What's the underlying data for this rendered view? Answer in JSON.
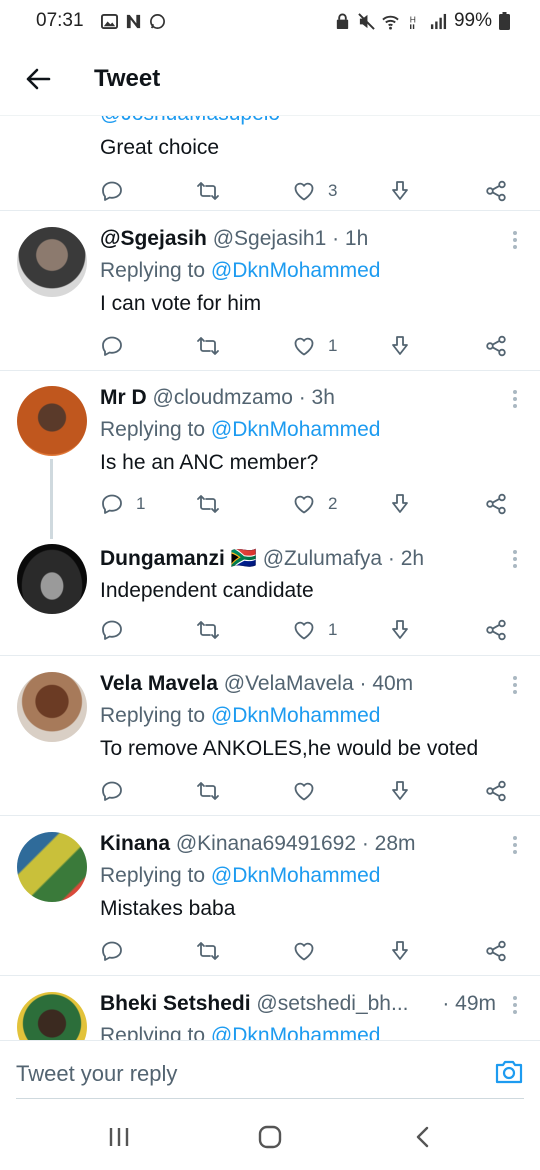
{
  "status_bar": {
    "time": "07:31",
    "notification_icons": [
      "gallery-icon",
      "n-app-icon",
      "whatsapp-icon"
    ],
    "status_icons": [
      "lock-icon",
      "mute-icon",
      "wifi-icon",
      "h-plus-icon",
      "signal-icon"
    ],
    "battery": "99%"
  },
  "header": {
    "title": "Tweet"
  },
  "clipped_top": {
    "handle_fragment": "@JoshuaMasupelo",
    "text": "Great choice",
    "likes": "3"
  },
  "tweets": [
    {
      "name": "@Sgejasih",
      "handle": "@Sgejasih1",
      "time": "· 1h",
      "replying_prefix": "Replying to ",
      "replying_to": "@DknMohammed",
      "text": "I can vote for him",
      "replies": "",
      "likes": "1"
    },
    {
      "name": "Mr D",
      "handle": "@cloudmzamo",
      "time": "· 3h",
      "replying_prefix": "Replying to ",
      "replying_to": "@DknMohammed",
      "text": "Is he an ANC member?",
      "replies": "1",
      "likes": "2"
    },
    {
      "name": "Dungamanzi",
      "flag": "🇿🇦",
      "handle": "@Zulumafya",
      "time": "· 2h",
      "text": "Independent candidate",
      "replies": "",
      "likes": "1"
    },
    {
      "name": "Vela Mavela",
      "handle": "@VelaMavela",
      "time": "· 40m",
      "replying_prefix": "Replying to ",
      "replying_to": "@DknMohammed",
      "text": "To remove ANKOLES,he would be voted",
      "replies": "",
      "likes": ""
    },
    {
      "name": "Kinana",
      "handle": "@Kinana69491692",
      "time": "· 28m",
      "replying_prefix": "Replying to ",
      "replying_to": "@DknMohammed",
      "text": "Mistakes baba",
      "replies": "",
      "likes": ""
    },
    {
      "name": "Bheki Setshedi",
      "handle": "@setshedi_bh...",
      "time": "· 49m",
      "replying_prefix": "Replying to ",
      "replying_to": "@DknMohammed"
    }
  ],
  "compose": {
    "placeholder": "Tweet your reply"
  },
  "nav": {
    "buttons": [
      "recents-icon",
      "home-icon",
      "back-icon"
    ]
  },
  "colors": {
    "accent": "#1d9bf0",
    "text": "#0f1419",
    "muted": "#536471",
    "divider": "#e6ecf0"
  }
}
